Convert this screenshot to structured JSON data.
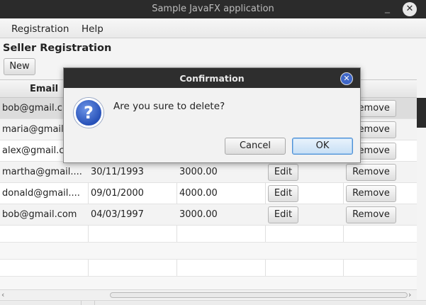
{
  "window": {
    "title": "Sample JavaFX application",
    "minimize_glyph": "_",
    "close_glyph": "✕"
  },
  "menu": {
    "items": [
      {
        "label": "Registration"
      },
      {
        "label": "Help"
      }
    ]
  },
  "page": {
    "title": "Seller Registration",
    "new_button": "New"
  },
  "table": {
    "columns": [
      {
        "label": "Email"
      }
    ],
    "rows": [
      {
        "email": "bob@gmail.c",
        "date": "",
        "amount": "",
        "edit": "",
        "remove": "Remove"
      },
      {
        "email": "maria@gmail",
        "date": "",
        "amount": "",
        "edit": "",
        "remove": "Remove"
      },
      {
        "email": "alex@gmail.c",
        "date": "",
        "amount": "",
        "edit": "",
        "remove": "Remove"
      },
      {
        "email": "martha@gmail....",
        "date": "30/11/1993",
        "amount": "3000.00",
        "edit": "Edit",
        "remove": "Remove"
      },
      {
        "email": "donald@gmail....",
        "date": "09/01/2000",
        "amount": "4000.00",
        "edit": "Edit",
        "remove": "Remove"
      },
      {
        "email": "bob@gmail.com",
        "date": "04/03/1997",
        "amount": "3000.00",
        "edit": "Edit",
        "remove": "Remove"
      }
    ],
    "scroll": {
      "left_arrow": "‹",
      "right_arrow": "›"
    }
  },
  "dialog": {
    "title": "Confirmation",
    "close_glyph": "✕",
    "icon_glyph": "?",
    "message": "Are you sure to delete?",
    "cancel": "Cancel",
    "ok": "OK"
  },
  "colors": {
    "titlebar": "#2b2b2b",
    "dialog_close": "#3f67c8",
    "info_icon": "#2751b8",
    "ok_border": "#4b8fd6"
  }
}
